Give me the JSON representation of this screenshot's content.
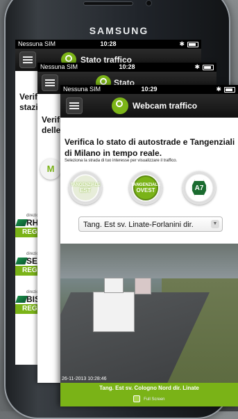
{
  "device": {
    "brand": "SAMSUNG"
  },
  "screens": [
    {
      "status": {
        "carrier": "Nessuna SIM",
        "time": "10:28"
      },
      "title": "Stato traffico",
      "peek_lines": [
        "Verifi",
        "stazi"
      ],
      "regional": [
        {
          "label": "direzion",
          "code": "RHO",
          "button": "REG"
        },
        {
          "label": "direzion",
          "code": "SES",
          "button": "REG"
        },
        {
          "label": "direzion",
          "code": "BISC",
          "button": "REG"
        }
      ]
    },
    {
      "status": {
        "carrier": "Nessuna SIM",
        "time": "10:28"
      },
      "title": "Stato",
      "peek_lines": [
        "Verifi",
        "delle"
      ],
      "badge": "M"
    },
    {
      "status": {
        "carrier": "Nessuna SIM",
        "time": "10:29"
      },
      "title": "Webcam traffico",
      "headline": "Verifica lo stato di autostrade e Tangenziali di Milano in tempo reale.",
      "subtext": "Seleziona la strada di tuo interesse per visualizzare il traffico.",
      "buttons": [
        {
          "line1": "TANGENZIALE",
          "line2": "EST"
        },
        {
          "line1": "TANGENZIALE",
          "line2": "OVEST"
        },
        {
          "line1": "A7",
          "line2": ""
        }
      ],
      "dropdown": "Tang. Est sv. Linate-Forlanini dir.",
      "webcam_timestamp": "26-11-2013 10:28:46",
      "caption": "Tang. Est sv. Cologno Nord dir. Linate",
      "fullscreen": "Full Screen"
    }
  ]
}
